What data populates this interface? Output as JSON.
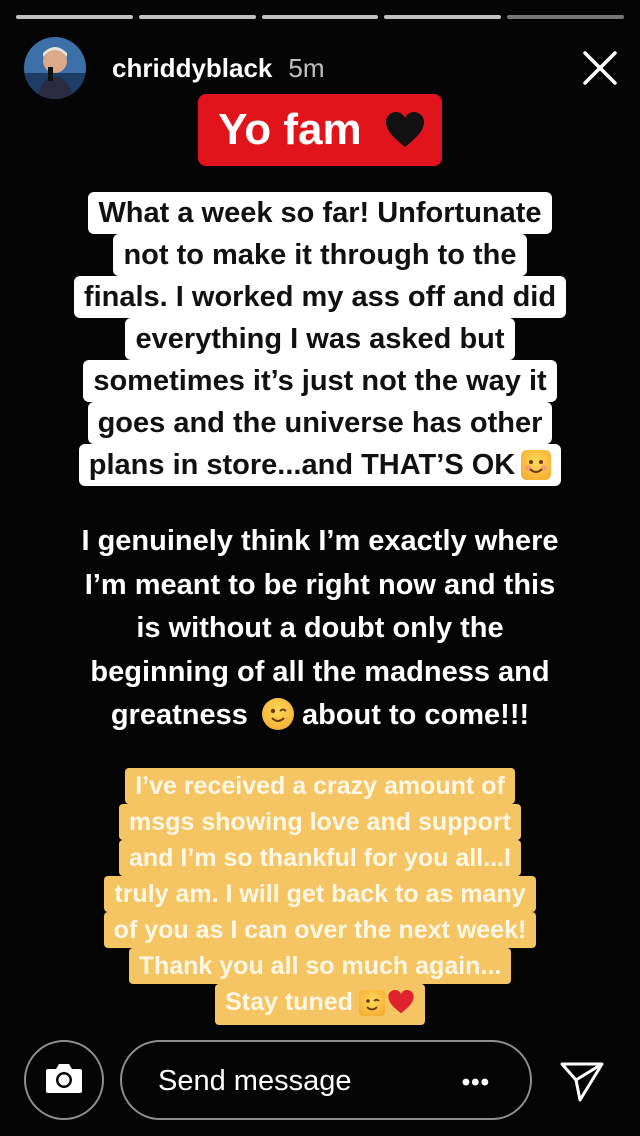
{
  "story": {
    "progress_segments": 5,
    "current_segment_index": 4,
    "user": {
      "username": "chriddyblack",
      "time_ago": "5m"
    },
    "headline": "Yo fam",
    "white_lines": [
      "What a week so far! Unfortunate",
      "not to make it through to the",
      "finals. I worked my ass off and did",
      "everything I was asked but",
      "sometimes it’s just not the way it",
      "goes and the universe has other",
      "plans in store...and THAT’S OK"
    ],
    "plain_lines": [
      "I genuinely think I’m exactly where",
      "I’m meant to be right now and this",
      "is without a doubt only the",
      "beginning of all the madness and"
    ],
    "plain_last": {
      "before": "greatness",
      "after": "about to come!!!"
    },
    "yellow_lines": [
      "I’ve received a crazy amount of",
      "msgs showing love and support",
      "and I’m so thankful for you all...I",
      "truly am. I will get back to as many",
      "of you as I can over the next week!",
      "Thank you all so much again..."
    ],
    "yellow_last": "Stay tuned",
    "colors": {
      "headline_bg": "#e1141b",
      "yellow_bg": "#f5c463",
      "background": "#050505"
    },
    "icons": [
      "close-icon",
      "black-heart-emoji",
      "smiling-face-emoji",
      "winking-face-emoji",
      "red-heart-emoji",
      "camera-icon",
      "more-options-icon",
      "direct-send-icon"
    ]
  },
  "footer": {
    "send_placeholder": "Send message",
    "more_label": "•••"
  }
}
